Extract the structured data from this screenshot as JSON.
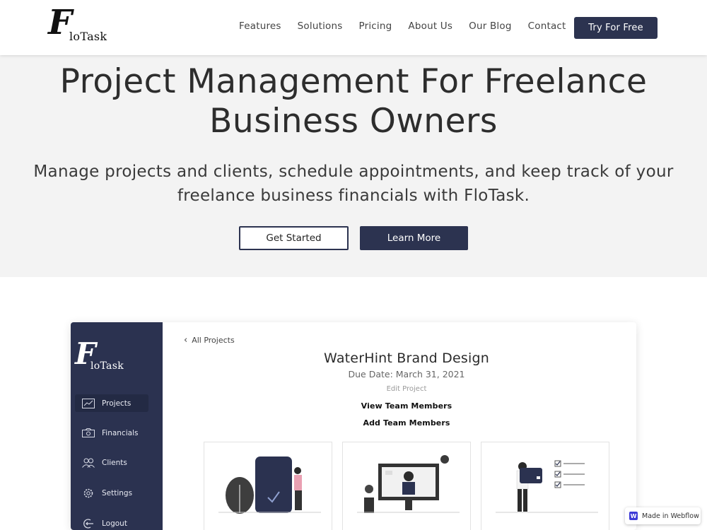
{
  "nav": {
    "logo_letter": "F",
    "logo_text": "loTask",
    "links": [
      "Features",
      "Solutions",
      "Pricing",
      "About Us",
      "Our Blog",
      "Contact"
    ],
    "cta": "Try For Free"
  },
  "hero": {
    "title_line1": "Project Management For Freelance",
    "title_line2": "Business Owners",
    "subtitle_line1": "Manage projects and clients, schedule appointments, and keep track of your",
    "subtitle_line2": "freelance business financials with FloTask.",
    "primary_button": "Get Started",
    "secondary_button": "Learn More"
  },
  "app": {
    "logo_letter": "F",
    "logo_text": "loTask",
    "sidebar": [
      {
        "label": "Projects",
        "icon": "chart-icon",
        "active": true
      },
      {
        "label": "Financials",
        "icon": "money-icon",
        "active": false
      },
      {
        "label": "Clients",
        "icon": "users-icon",
        "active": false
      },
      {
        "label": "Settings",
        "icon": "gear-icon",
        "active": false
      },
      {
        "label": "Logout",
        "icon": "logout-icon",
        "active": false
      }
    ],
    "back_link": "All Projects",
    "project_title": "WaterHint Brand Design",
    "due_date": "Due Date: March 31, 2021",
    "edit_link": "Edit Project",
    "view_team": "View Team Members",
    "add_team": "Add Team Members"
  },
  "badge": {
    "text": "Made in Webflow",
    "logo": "W"
  },
  "colors": {
    "primary": "#2c3350",
    "hero_bg": "#f3f3f3",
    "sidebar_bg": "#2b3250"
  }
}
